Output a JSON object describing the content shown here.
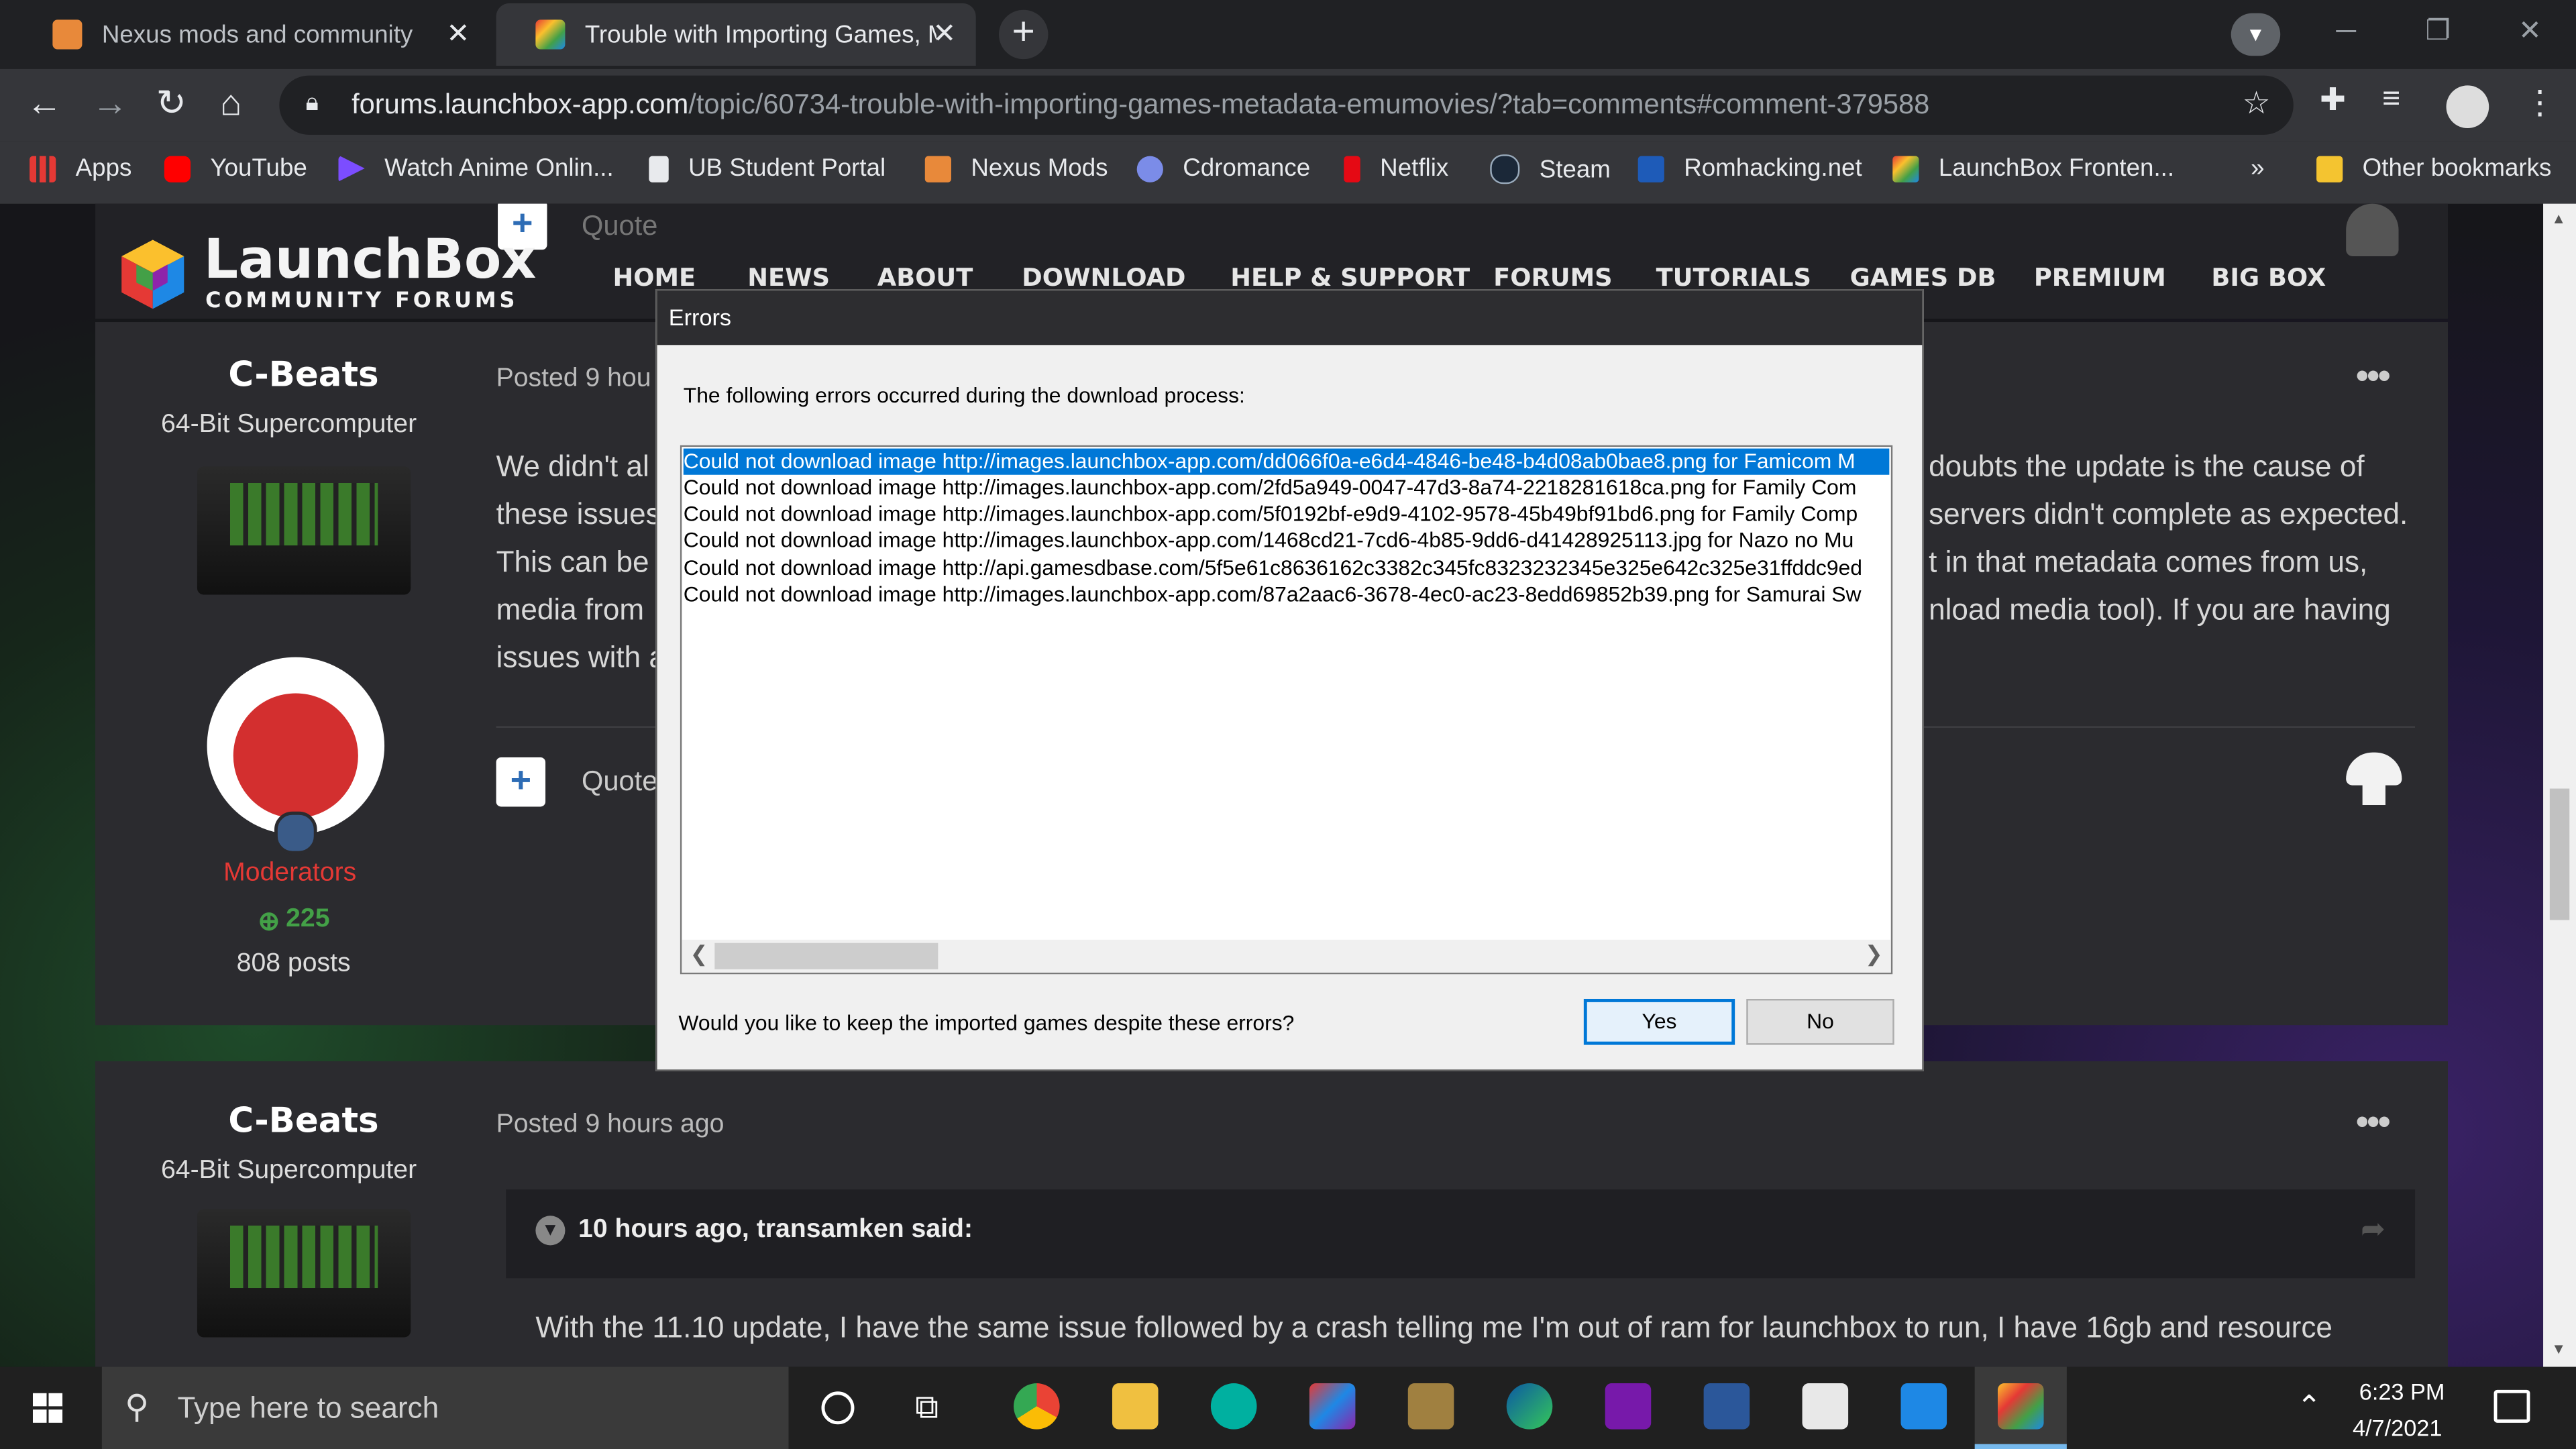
{
  "browser": {
    "tabs": [
      {
        "title": "Nexus mods and community",
        "active": false
      },
      {
        "title": "Trouble with Importing Games, M",
        "active": true
      }
    ],
    "url_host": "forums.launchbox-app.com",
    "url_path": "/topic/60734-trouble-with-importing-games-metadata-emumovies/?tab=comments#comment-379588",
    "bookmarks": [
      "Apps",
      "YouTube",
      "Watch Anime Onlin...",
      "UB Student Portal",
      "Nexus Mods",
      "Cdromance",
      "Netflix",
      "Steam",
      "Romhacking.net",
      "LaunchBox Fronten..."
    ],
    "bookmarks_overflow": "»",
    "other_bookmarks": "Other bookmarks"
  },
  "site": {
    "logo_name": "LaunchBox",
    "logo_sub": "COMMUNITY FORUMS",
    "menu": [
      "HOME",
      "NEWS",
      "ABOUT",
      "DOWNLOAD",
      "HELP & SUPPORT",
      "FORUMS",
      "TUTORIALS",
      "GAMES DB",
      "PREMIUM",
      "BIG BOX"
    ]
  },
  "posts": [
    {
      "author": "C-Beats",
      "rank": "64-Bit Supercomputer",
      "posted": "Posted 9 hou",
      "body_left": [
        "We didn't al",
        "these issues",
        "This can be",
        "media from",
        "issues with a"
      ],
      "body_right": [
        "doubts the update is the cause of",
        "servers didn't complete as expected.",
        "t in that metadata comes from us,",
        "nload media tool). If you are having"
      ],
      "group": "Moderators",
      "reputation": "225",
      "post_count": "808 posts",
      "quote": "Quote",
      "more": "•••"
    },
    {
      "author": "C-Beats",
      "rank": "64-Bit Supercomputer",
      "posted": "Posted 9 hours ago",
      "quote_header": "10 hours ago, transamken said:",
      "quote_text": "With the 11.10 update, I have the same issue followed by a crash telling me I'm out of ram for launchbox to run, I have 16gb and resource",
      "more": "•••"
    }
  ],
  "top_quote": "Quote",
  "dialog": {
    "title": "Errors",
    "message": "The following errors occurred during the download process:",
    "errors": [
      "Could not download image http://images.launchbox-app.com/dd066f0a-e6d4-4846-be48-b4d08ab0bae8.png for Famicom M",
      "Could not download image http://images.launchbox-app.com/2fd5a949-0047-47d3-8a74-2218281618ca.png for Family Com",
      "Could not download image http://images.launchbox-app.com/5f0192bf-e9d9-4102-9578-45b49bf91bd6.png for Family Comp",
      "Could not download image http://images.launchbox-app.com/1468cd21-7cd6-4b85-9dd6-d41428925113.jpg for Nazo no Mu",
      "Could not download image http://api.gamesdbase.com/5f5e61c8636162c3382c345fc8323232345e325e642c325e31ffddc9ed",
      "Could not download image http://images.launchbox-app.com/87a2aac6-3678-4ec0-ac23-8edd69852b39.png for Samurai Sw"
    ],
    "selected_index": 0,
    "question": "Would you like to keep the imported games despite these errors?",
    "yes": "Yes",
    "no": "No"
  },
  "taskbar": {
    "search_placeholder": "Type here to search",
    "time": "6:23 PM",
    "date": "4/7/2021"
  }
}
